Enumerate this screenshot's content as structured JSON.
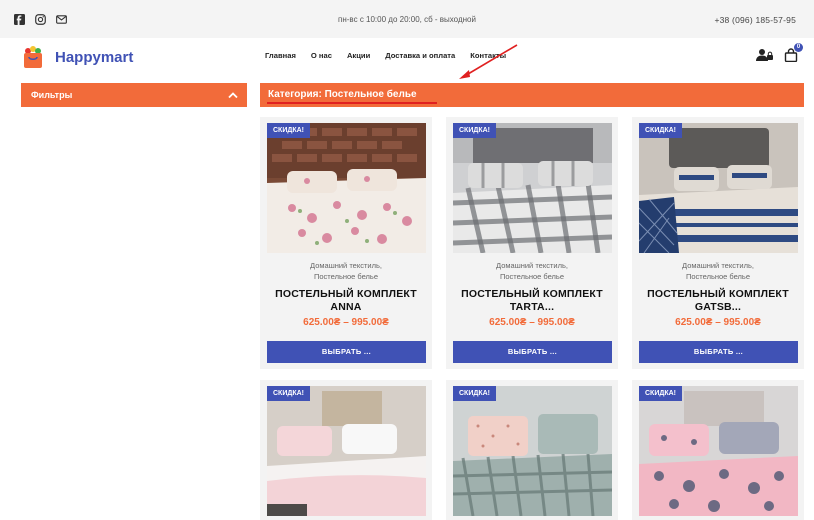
{
  "topbar": {
    "hours": "пн-вс с 10:00 до 20:00, сб - выходной",
    "phone": "+38 (096) 185-57-95"
  },
  "header": {
    "logo_text": "Happymart",
    "nav": [
      "Главная",
      "О нас",
      "Акции",
      "Доставка и оплата",
      "Контакты"
    ],
    "cart_count": "0"
  },
  "sidebar": {
    "filters_label": "Фильтры"
  },
  "category": {
    "title": "Категория: Постельное белье"
  },
  "colors": {
    "accent": "#f26b3a",
    "brand": "#4052b5"
  },
  "products": [
    {
      "badge": "СКИДКА!",
      "cat1": "Домашний текстиль,",
      "cat2": "Постельное белье",
      "title1": "ПОСТЕЛЬНЫЙ КОМПЛЕКТ",
      "title2": "ANNA",
      "price": "625.00₴ – 995.00₴",
      "button": "ВЫБРАТЬ ..."
    },
    {
      "badge": "СКИДКА!",
      "cat1": "Домашний текстиль,",
      "cat2": "Постельное белье",
      "title1": "ПОСТЕЛЬНЫЙ КОМПЛЕКТ",
      "title2": "TARTA...",
      "price": "625.00₴ – 995.00₴",
      "button": "ВЫБРАТЬ ..."
    },
    {
      "badge": "СКИДКА!",
      "cat1": "Домашний текстиль,",
      "cat2": "Постельное белье",
      "title1": "ПОСТЕЛЬНЫЙ КОМПЛЕКТ",
      "title2": "GATSB...",
      "price": "625.00₴ – 995.00₴",
      "button": "ВЫБРАТЬ ..."
    },
    {
      "badge": "СКИДКА!"
    },
    {
      "badge": "СКИДКА!"
    },
    {
      "badge": "СКИДКА!"
    }
  ]
}
